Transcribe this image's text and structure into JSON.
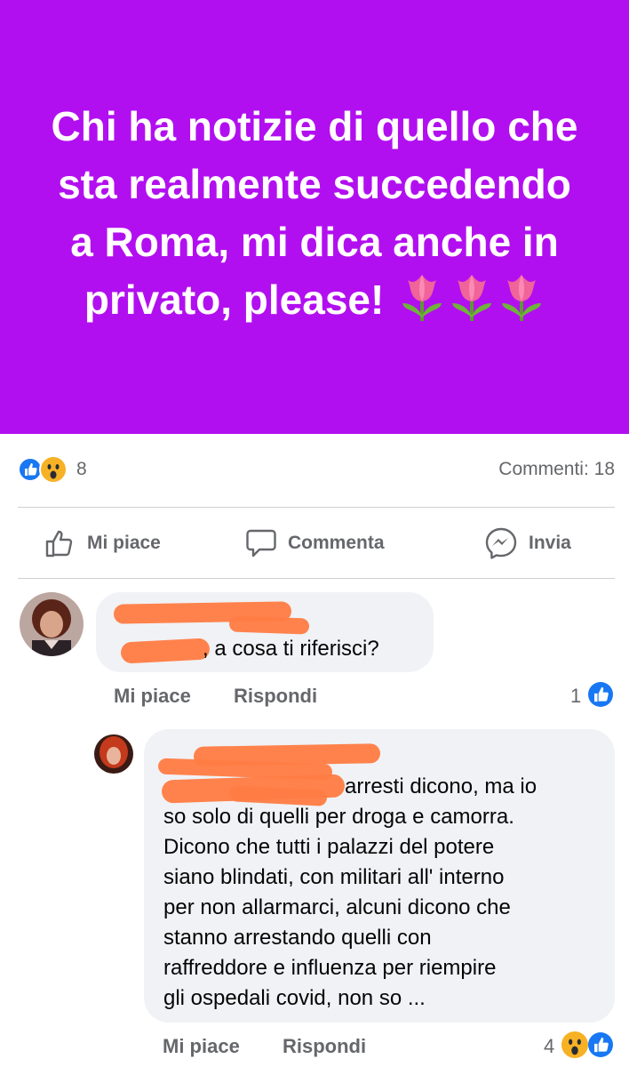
{
  "post": {
    "text": "Chi ha notizie di quello che sta realmente succedendo a Roma, mi dica anche in privato, please!",
    "emoji": [
      "tulip",
      "tulip",
      "tulip"
    ],
    "background_color": "#b20ff0"
  },
  "reactions": {
    "icons": [
      "like-icon",
      "wow-icon"
    ],
    "count": "8",
    "comments_label": "Commenti: 18"
  },
  "actions": {
    "like_label": "Mi piace",
    "comment_label": "Commenta",
    "send_label": "Invia"
  },
  "comments": [
    {
      "text": ", a cosa ti riferisci?",
      "like_label": "Mi piace",
      "reply_label": "Rispondi",
      "reaction_count": "1",
      "reaction_icons": [
        "like-icon"
      ]
    },
    {
      "lines": [
        "arresti dicono, ma io",
        "so solo di quelli per droga e camorra.",
        "Dicono che tutti i palazzi del potere",
        "siano blindati,  con militari all' interno",
        "per non allarmarci, alcuni dicono che",
        "stanno arrestando quelli con",
        "raffreddore e influenza per riempire",
        "gli ospedali covid, non so ..."
      ],
      "like_label": "Mi piace",
      "reply_label": "Rispondi",
      "reaction_count": "4",
      "reaction_icons": [
        "wow-icon",
        "like-icon"
      ]
    }
  ]
}
